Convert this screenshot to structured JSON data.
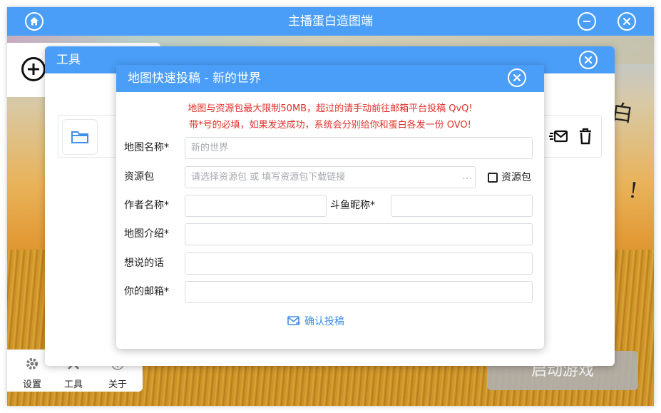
{
  "app": {
    "title": "主播蛋白造图端",
    "accent_color": "#4a9ef8",
    "icons": {
      "home": "home-icon",
      "minimize": "minimize-icon",
      "close": "close-icon"
    }
  },
  "background": {
    "handwriting": [
      "白",
      "!"
    ]
  },
  "bottom_nav": {
    "items": [
      {
        "label": "设置",
        "icon": "gear-icon"
      },
      {
        "label": "工具",
        "icon": "tools-icon"
      },
      {
        "label": "关于",
        "icon": "info-icon"
      }
    ]
  },
  "start_button": {
    "label": "启动游戏"
  },
  "tool_dialog": {
    "title": "工具",
    "row_icons": [
      "folder-icon",
      "mail-icon",
      "trash-icon"
    ]
  },
  "submit_dialog": {
    "title": "地图快速投稿 - 新的世界",
    "notice_line1": "地图与资源包最大限制50MB，超过的请手动前往邮箱平台投稿 QvQ!",
    "notice_line2": "带*号的必填，如果发送成功，系统会分别给你和蛋白各发一份 OVO!",
    "notice_color": "#e0302a",
    "fields": {
      "map_name": {
        "label": "地图名称*",
        "placeholder": "新的世界",
        "value": ""
      },
      "resource_pack": {
        "label": "资源包",
        "placeholder": "请选择资源包 或 填写资源包下载链接",
        "more": "···"
      },
      "resource_checkbox": {
        "label": "资源包",
        "checked": false
      },
      "author": {
        "label": "作者名称*",
        "value": ""
      },
      "douyu": {
        "label": "斗鱼昵称*",
        "value": ""
      },
      "intro": {
        "label": "地图介绍*",
        "value": ""
      },
      "message": {
        "label": "想说的话",
        "value": ""
      },
      "email": {
        "label": "你的邮箱*",
        "value": ""
      }
    },
    "confirm_label": "确认投稿"
  }
}
